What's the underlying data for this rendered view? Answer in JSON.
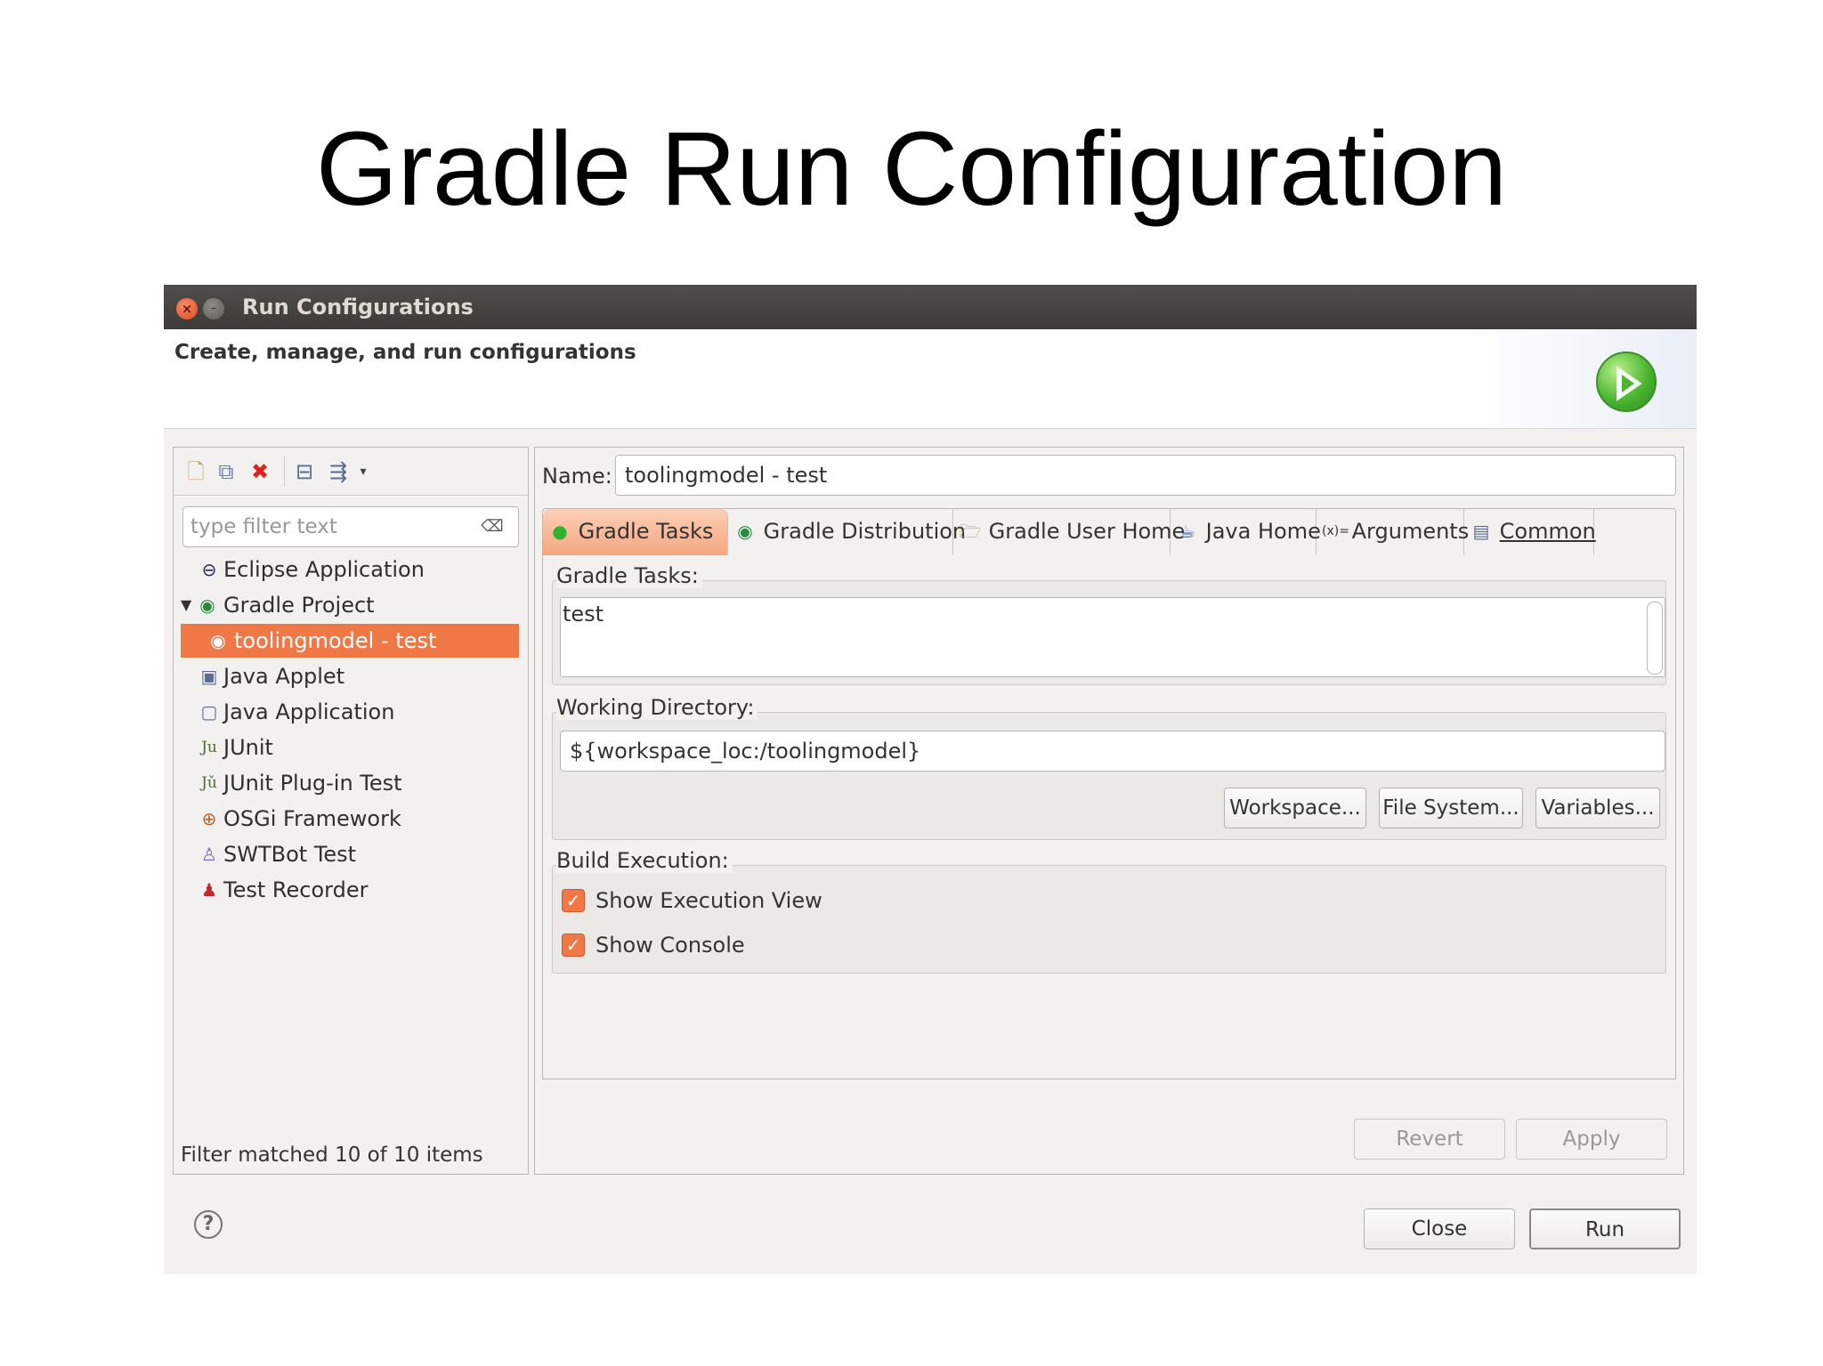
{
  "slide": {
    "title": "Gradle Run Configuration"
  },
  "window": {
    "title": "Run Configurations",
    "header": "Create, manage, and run configurations"
  },
  "left": {
    "filter_placeholder": "type filter text",
    "tree": [
      {
        "label": "Eclipse Application",
        "icon": "eclipse-icon"
      },
      {
        "label": "Gradle Project",
        "icon": "gradle-icon",
        "expanded": true
      },
      {
        "label": "toolingmodel - test",
        "icon": "gradle-config-icon",
        "selected": true
      },
      {
        "label": "Java Applet",
        "icon": "java-applet-icon"
      },
      {
        "label": "Java Application",
        "icon": "java-application-icon"
      },
      {
        "label": "JUnit",
        "icon": "junit-icon"
      },
      {
        "label": "JUnit Plug-in Test",
        "icon": "junit-plugin-icon"
      },
      {
        "label": "OSGi Framework",
        "icon": "osgi-icon"
      },
      {
        "label": "SWTBot Test",
        "icon": "swtbot-icon"
      },
      {
        "label": "Test Recorder",
        "icon": "test-recorder-icon"
      }
    ],
    "status": "Filter matched 10 of 10 items"
  },
  "right": {
    "name_label": "Name:",
    "name_value": "toolingmodel - test",
    "tabs": [
      {
        "label": "Gradle Tasks",
        "active": true
      },
      {
        "label": "Gradle Distribution"
      },
      {
        "label": "Gradle User Home"
      },
      {
        "label": "Java Home"
      },
      {
        "label": "Arguments"
      },
      {
        "label": "Common"
      }
    ],
    "gradle_tasks_label": "Gradle Tasks:",
    "gradle_tasks_value": "test",
    "working_dir_label": "Working Directory:",
    "working_dir_value": "${workspace_loc:/toolingmodel}",
    "buttons": {
      "workspace": "Workspace...",
      "file_system": "File System...",
      "variables": "Variables..."
    },
    "build_exec_label": "Build Execution:",
    "checkboxes": [
      {
        "label": "Show Execution View",
        "checked": true
      },
      {
        "label": "Show Console",
        "checked": true
      }
    ],
    "revert": "Revert",
    "apply": "Apply"
  },
  "footer": {
    "close": "Close",
    "run": "Run"
  },
  "colors": {
    "accent": "#f07746",
    "titlebar": "#3c3b37",
    "run_green": "#4cb531"
  }
}
